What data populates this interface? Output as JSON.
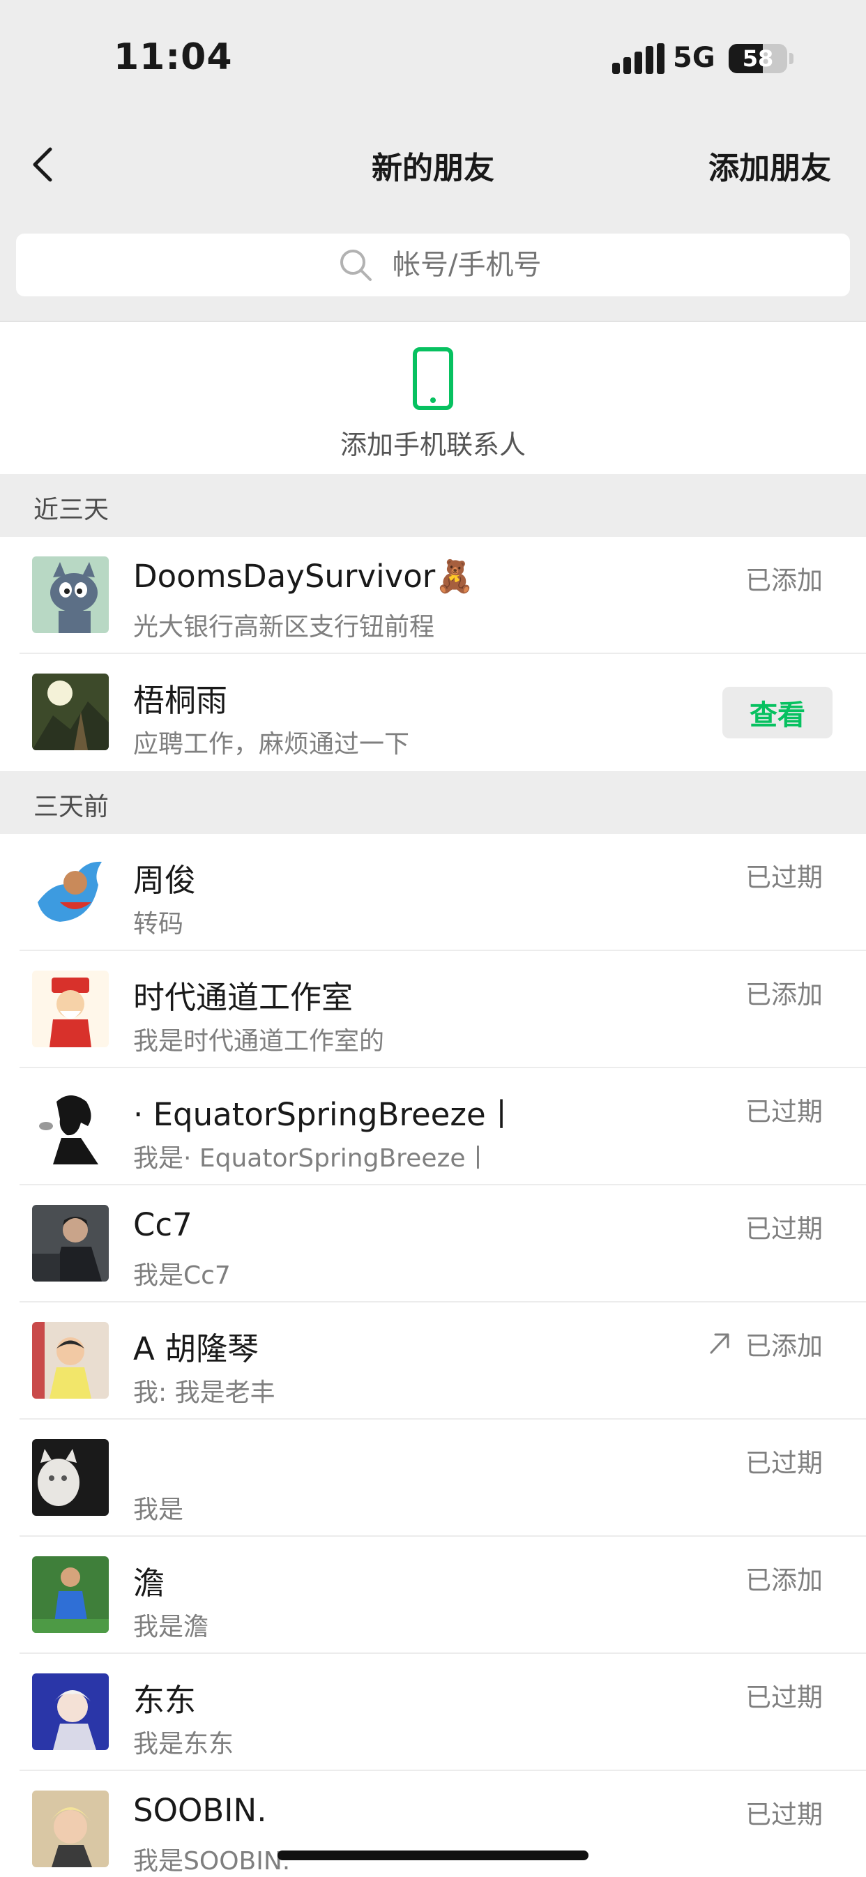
{
  "status_bar": {
    "time": "11:04",
    "network": "5G",
    "battery": "58",
    "battery_level": 0.58
  },
  "navbar": {
    "title": "新的朋友",
    "action": "添加朋友"
  },
  "search": {
    "placeholder": "帐号/手机号"
  },
  "add_contacts": {
    "label": "添加手机联系人"
  },
  "colors": {
    "accent": "#07c160",
    "background": "#ededed"
  },
  "sections": [
    {
      "title": "近三天",
      "rows": [
        {
          "name": "DoomsDaySurvivor🧸",
          "message": "光大银行高新区支行钮前程",
          "status": "已添加"
        },
        {
          "name": "梧桐雨",
          "message": "应聘工作，麻烦通过一下",
          "status": "查看"
        }
      ]
    },
    {
      "title": "三天前",
      "rows": [
        {
          "name": "周俊",
          "message": "转码",
          "status": "已过期"
        },
        {
          "name": "时代通道工作室",
          "message": "我是时代通道工作室的",
          "status": "已添加"
        },
        {
          "name": "· EquatorSpringBreeze丨",
          "message": "我是· EquatorSpringBreeze丨",
          "status": "已过期"
        },
        {
          "name": "Cc7",
          "message": "我是Cc7",
          "status": "已过期"
        },
        {
          "name": "A 胡隆琴",
          "message": "我: 我是老丰",
          "status": "已添加"
        },
        {
          "name": "",
          "message": "我是",
          "status": "已过期"
        },
        {
          "name": "澹",
          "message": "我是澹",
          "status": "已添加"
        },
        {
          "name": "东东",
          "message": "我是东东",
          "status": "已过期"
        },
        {
          "name": "SOOBIN.",
          "message": "我是SOOBIN.",
          "status": "已过期"
        }
      ]
    }
  ]
}
